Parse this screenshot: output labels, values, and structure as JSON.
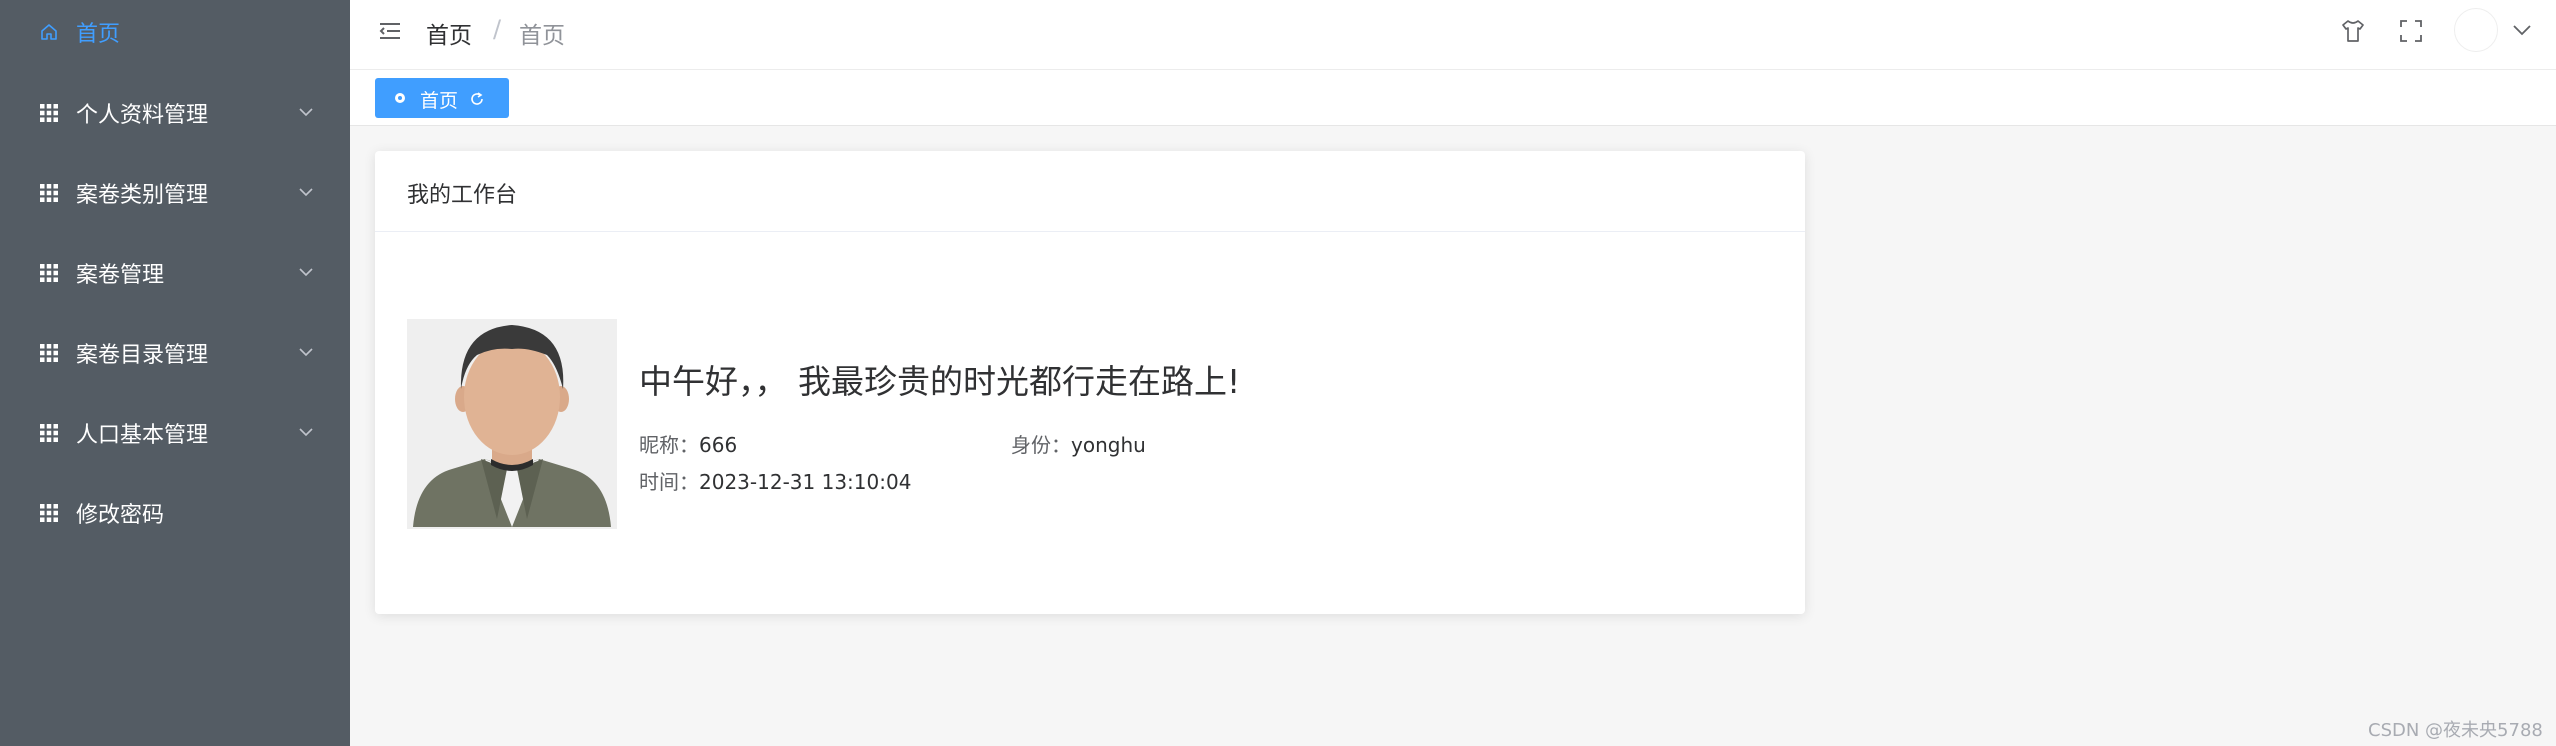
{
  "sidebar": {
    "items": [
      {
        "label": "首页",
        "icon": "home-icon",
        "active": true,
        "has_submenu": false
      },
      {
        "label": "个人资料管理",
        "icon": "grid-icon",
        "active": false,
        "has_submenu": true
      },
      {
        "label": "案卷类别管理",
        "icon": "grid-icon",
        "active": false,
        "has_submenu": true
      },
      {
        "label": "案卷管理",
        "icon": "grid-icon",
        "active": false,
        "has_submenu": true
      },
      {
        "label": "案卷目录管理",
        "icon": "grid-icon",
        "active": false,
        "has_submenu": true
      },
      {
        "label": "人口基本管理",
        "icon": "grid-icon",
        "active": false,
        "has_submenu": true
      },
      {
        "label": "修改密码",
        "icon": "grid-icon",
        "active": false,
        "has_submenu": false
      }
    ]
  },
  "header": {
    "breadcrumb": [
      "首页",
      "首页"
    ],
    "separator": "/",
    "icons": [
      "menu-fold-icon",
      "tshirt-icon",
      "fullscreen-icon",
      "user-avatar-icon",
      "chevron-down-icon"
    ]
  },
  "tags": {
    "active_tag": "首页"
  },
  "card": {
    "title": "我的工作台",
    "greeting": "中午好，，  我最珍贵的时光都行走在路上!",
    "nickname_label": "昵称：",
    "nickname_value": "666",
    "role_label": "身份：",
    "role_value": "yonghu",
    "time_label": "时间：",
    "time_value": "2023-12-31 13:10:04"
  },
  "watermark": "CSDN @夜未央5788",
  "colors": {
    "sidebar_bg": "#545c64",
    "accent": "#409eff",
    "page_bg": "#f6f6f6"
  }
}
